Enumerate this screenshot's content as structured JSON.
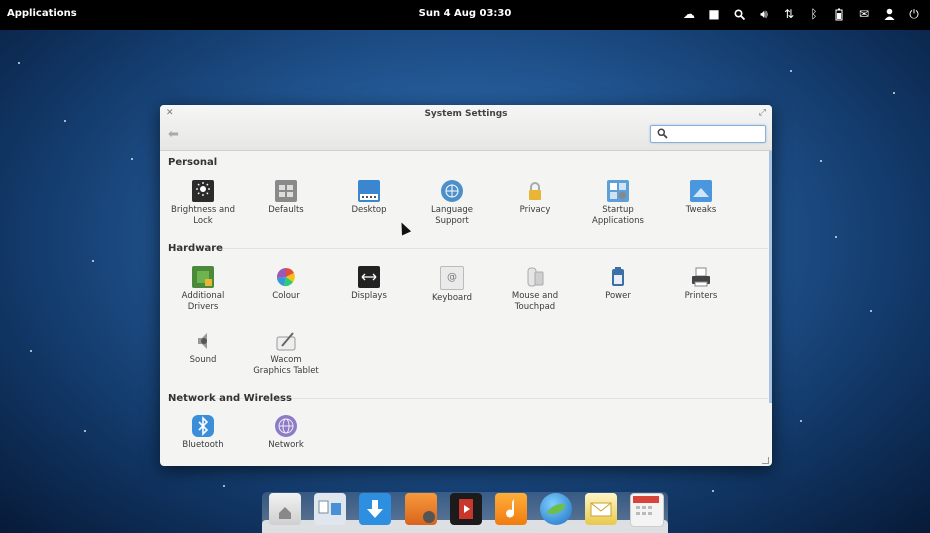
{
  "topbar": {
    "applications_label": "Applications",
    "clock": "Sun  4 Aug 03:30",
    "indicators": [
      "weather-icon",
      "workspace-icon",
      "search-icon",
      "volume-icon",
      "network-icon",
      "bluetooth-icon",
      "battery-icon",
      "mail-icon",
      "user-icon",
      "power-icon"
    ]
  },
  "window": {
    "title": "System Settings",
    "search_placeholder": "",
    "sections": [
      {
        "title": "Personal",
        "items": [
          {
            "label": "Brightness and\nLock",
            "icon": "brightness-lock-icon"
          },
          {
            "label": "Defaults",
            "icon": "defaults-icon"
          },
          {
            "label": "Desktop",
            "icon": "desktop-icon"
          },
          {
            "label": "Language\nSupport",
            "icon": "language-icon"
          },
          {
            "label": "Privacy",
            "icon": "privacy-lock-icon"
          },
          {
            "label": "Startup\nApplications",
            "icon": "startup-apps-icon"
          },
          {
            "label": "Tweaks",
            "icon": "tweaks-icon"
          }
        ]
      },
      {
        "title": "Hardware",
        "items": [
          {
            "label": "Additional\nDrivers",
            "icon": "drivers-chip-icon"
          },
          {
            "label": "Colour",
            "icon": "colour-wheel-icon"
          },
          {
            "label": "Displays",
            "icon": "displays-icon"
          },
          {
            "label": "Keyboard",
            "icon": "keyboard-icon"
          },
          {
            "label": "Mouse and\nTouchpad",
            "icon": "mouse-icon"
          },
          {
            "label": "Power",
            "icon": "power-battery-icon"
          },
          {
            "label": "Printers",
            "icon": "printer-icon"
          },
          {
            "label": "Sound",
            "icon": "speaker-icon"
          },
          {
            "label": "Wacom\nGraphics Tablet",
            "icon": "tablet-pen-icon"
          }
        ]
      },
      {
        "title": "Network and Wireless",
        "items": [
          {
            "label": "Bluetooth",
            "icon": "bluetooth-icon"
          },
          {
            "label": "Network",
            "icon": "network-globe-icon"
          }
        ]
      }
    ]
  },
  "dock": {
    "apps": [
      "home-folder-icon",
      "multitasking-icon",
      "downloads-icon",
      "photos-icon",
      "video-player-icon",
      "music-icon",
      "browser-icon",
      "mail-icon",
      "calendar-icon"
    ]
  },
  "colors": {
    "accent": "#3b8fd9",
    "panel": "#000000",
    "window_bg": "#f4f4f3"
  }
}
